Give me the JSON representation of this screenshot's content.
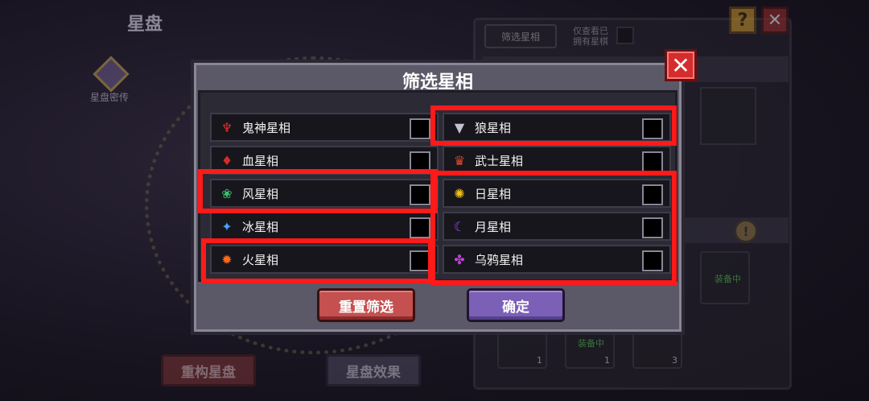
{
  "screen_title": "星盘",
  "legend_label": "星盘密传",
  "side_panel": {
    "filter_tab": "筛选星相",
    "owned_toggle_label": "仅查看已拥有星棋",
    "equipped_tags": [
      "装备中",
      "装备中"
    ],
    "slot_counts": [
      "1",
      "1",
      "3"
    ],
    "help_icon": "question-icon",
    "close_icon": "close-icon"
  },
  "bottom_buttons": {
    "rebuild": "重构星盘",
    "effect": "星盘效果"
  },
  "modal": {
    "title": "筛选星相",
    "left_column": [
      {
        "label": "鬼神星相",
        "icon": "demon-icon",
        "color": "#e0302a"
      },
      {
        "label": "血星相",
        "icon": "blood-drop-icon",
        "color": "#d82a2a"
      },
      {
        "label": "风星相",
        "icon": "wind-icon",
        "color": "#35c46a"
      },
      {
        "label": "冰星相",
        "icon": "ice-crystal-icon",
        "color": "#4aa0ff"
      },
      {
        "label": "火星相",
        "icon": "fire-icon",
        "color": "#ff6a1a"
      }
    ],
    "right_column": [
      {
        "label": "狼星相",
        "icon": "wolf-icon",
        "color": "#c0c4d0"
      },
      {
        "label": "武士星相",
        "icon": "samurai-icon",
        "color": "#e04a2a"
      },
      {
        "label": "日星相",
        "icon": "sun-icon",
        "color": "#f2c020"
      },
      {
        "label": "月星相",
        "icon": "moon-icon",
        "color": "#b040ff"
      },
      {
        "label": "乌鸦星相",
        "icon": "crow-icon",
        "color": "#c040d8"
      }
    ],
    "reset_label": "重置筛选",
    "confirm_label": "确定",
    "highlight_color": "#ff1a1a"
  }
}
